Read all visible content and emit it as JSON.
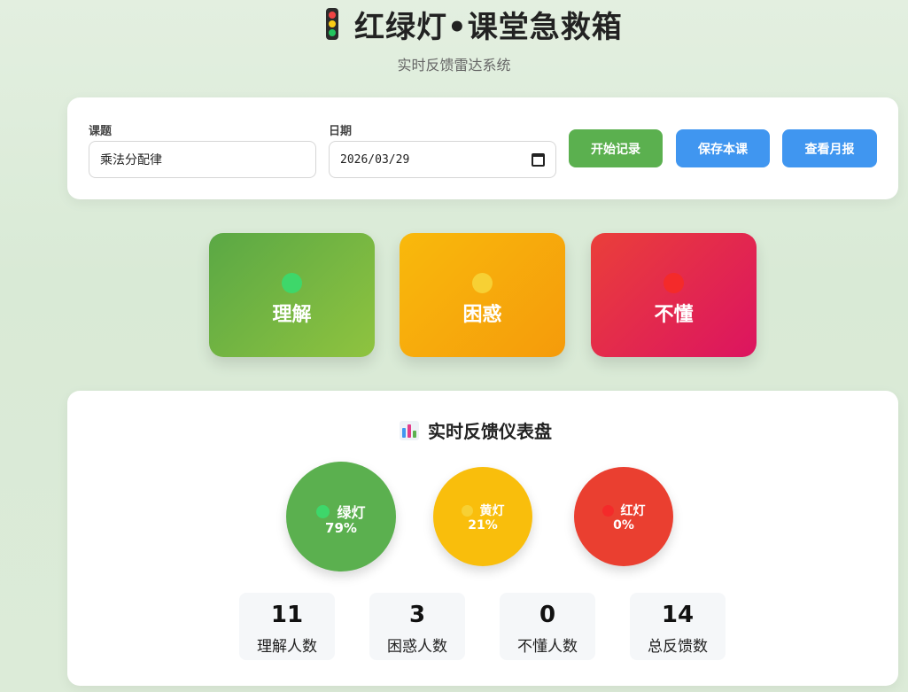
{
  "header": {
    "icon": "traffic-light-icon",
    "title": "红绿灯•课堂急救箱",
    "subtitle": "实时反馈雷达系统"
  },
  "form": {
    "topic_label": "课题",
    "topic_value": "乘法分配律",
    "date_label": "日期",
    "date_value": "2026/03/29",
    "start_button": "开始记录",
    "save_button": "保存本课",
    "report_button": "查看月报"
  },
  "signals": {
    "green_label": "理解",
    "yellow_label": "困惑",
    "red_label": "不懂"
  },
  "dashboard": {
    "icon": "bar-chart-icon",
    "title": "实时反馈仪表盘",
    "circles": {
      "green": {
        "label": "绿灯",
        "percent": "79%"
      },
      "yellow": {
        "label": "黄灯",
        "percent": "21%"
      },
      "red": {
        "label": "红灯",
        "percent": "0%"
      }
    },
    "stats": [
      {
        "value": "11",
        "label": "理解人数"
      },
      {
        "value": "3",
        "label": "困惑人数"
      },
      {
        "value": "0",
        "label": "不懂人数"
      },
      {
        "value": "14",
        "label": "总反馈数"
      }
    ]
  },
  "colors": {
    "green": "#5bb04f",
    "yellow": "#f9be0c",
    "red": "#ea3f30",
    "blue": "#4096f0"
  }
}
